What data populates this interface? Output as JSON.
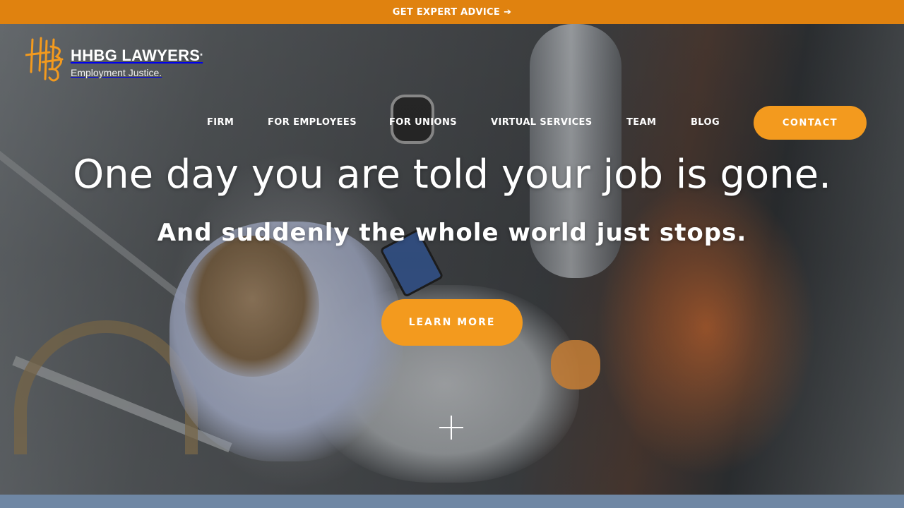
{
  "topbar": {
    "text": "GET EXPERT ADVICE",
    "icon": "arrow-right-icon",
    "arrow_glyph": "➔"
  },
  "logo": {
    "name": "HHBG LAWYERS",
    "trademark": "*",
    "tagline": "Employment Justice."
  },
  "nav": {
    "items": [
      {
        "label": "FIRM"
      },
      {
        "label": "FOR EMPLOYEES"
      },
      {
        "label": "FOR UNIONS"
      },
      {
        "label": "VIRTUAL SERVICES"
      },
      {
        "label": "TEAM"
      },
      {
        "label": "BLOG"
      }
    ],
    "contact_label": "CONTACT"
  },
  "hero": {
    "headline": "One day you are told your job is gone.",
    "subheadline": "And suddenly the whole world just stops.",
    "cta_label": "LEARN MORE",
    "expand_icon": "plus-icon"
  },
  "colors": {
    "accent": "#f39a1e",
    "topbar": "#e0820f",
    "bottom_strip": "#6f87a4"
  }
}
